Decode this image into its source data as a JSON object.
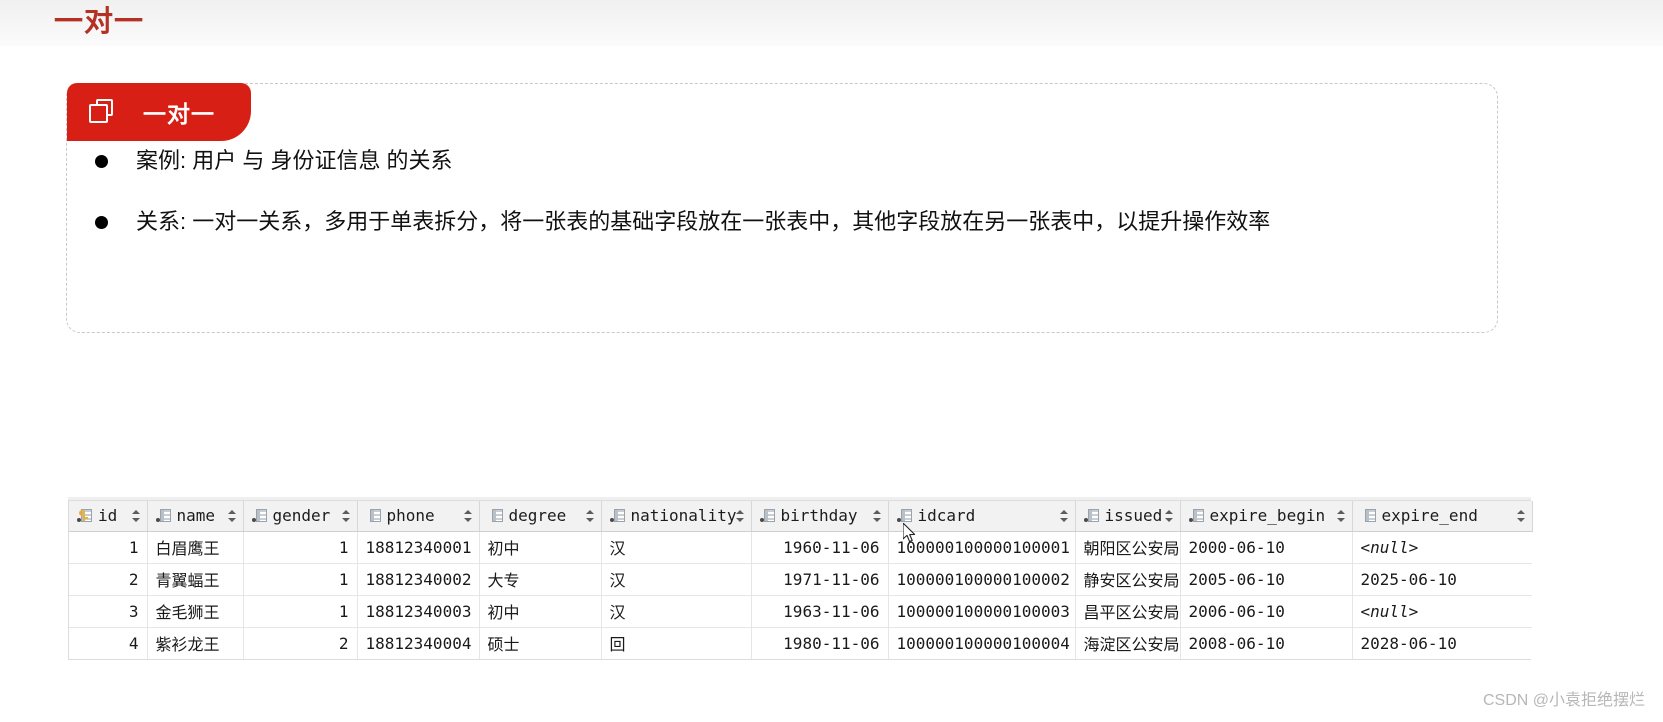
{
  "slide": {
    "title": "一对一"
  },
  "card": {
    "badge_label": "一对一",
    "badge_icon": "layers-icon",
    "badge_color": "#d71f16",
    "bullets": [
      "案例: 用户 与 身份证信息 的关系",
      "关系: 一对一关系，多用于单表拆分，将一张表的基础字段放在一张表中，其他字段放在另一张表中，以提升操作效率"
    ]
  },
  "grid": {
    "columns": [
      {
        "label": "id",
        "icon": "primary-key-column-icon",
        "align": "num"
      },
      {
        "label": "name",
        "icon": "column-icon",
        "align": "txt"
      },
      {
        "label": "gender",
        "icon": "column-icon",
        "align": "num"
      },
      {
        "label": "phone",
        "icon": "column-plain-icon",
        "align": "num"
      },
      {
        "label": "degree",
        "icon": "column-plain-icon",
        "align": "txt"
      },
      {
        "label": "nationality",
        "icon": "column-icon",
        "align": "txt"
      },
      {
        "label": "birthday",
        "icon": "column-icon",
        "align": "dat"
      },
      {
        "label": "idcard",
        "icon": "column-icon",
        "align": "dat"
      },
      {
        "label": "issued",
        "icon": "column-icon",
        "align": "txt"
      },
      {
        "label": "expire_begin",
        "icon": "column-icon",
        "align": "lft"
      },
      {
        "label": "expire_end",
        "icon": "column-plain-icon",
        "align": "lft"
      }
    ],
    "rows": [
      {
        "id": "1",
        "name": "白眉鹰王",
        "gender": "1",
        "phone": "18812340001",
        "degree": "初中",
        "nationality": "汉",
        "birthday": "1960-11-06",
        "idcard": "100000100000100001",
        "issued": "朝阳区公安局",
        "expire_begin": "2000-06-10",
        "expire_end": "<null>",
        "expire_end_is_null": true
      },
      {
        "id": "2",
        "name": "青翼蝠王",
        "gender": "1",
        "phone": "18812340002",
        "degree": "大专",
        "nationality": "汉",
        "birthday": "1971-11-06",
        "idcard": "100000100000100002",
        "issued": "静安区公安局",
        "expire_begin": "2005-06-10",
        "expire_end": "2025-06-10",
        "expire_end_is_null": false
      },
      {
        "id": "3",
        "name": "金毛狮王",
        "gender": "1",
        "phone": "18812340003",
        "degree": "初中",
        "nationality": "汉",
        "birthday": "1963-11-06",
        "idcard": "100000100000100003",
        "issued": "昌平区公安局",
        "expire_begin": "2006-06-10",
        "expire_end": "<null>",
        "expire_end_is_null": true
      },
      {
        "id": "4",
        "name": "紫衫龙王",
        "gender": "2",
        "phone": "18812340004",
        "degree": "硕士",
        "nationality": "回",
        "birthday": "1980-11-06",
        "idcard": "100000100000100004",
        "issued": "海淀区公安局",
        "expire_begin": "2008-06-10",
        "expire_end": "2028-06-10",
        "expire_end_is_null": false
      }
    ]
  },
  "watermark": "CSDN @小袁拒绝摆烂"
}
